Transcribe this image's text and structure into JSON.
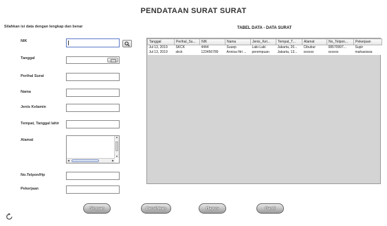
{
  "app_title": "PENDATAAN SURAT SURAT",
  "instruction": "Silahkan isi data dengan lengkap dan benar",
  "table_title": "TABEL DATA - DATA SURAT",
  "form": {
    "nik_label": "NIK",
    "tanggal_label": "Tanggal",
    "perihal_label": "Perihal Surat",
    "nama_label": "Nama",
    "jenis_kelamin_label": "Jenis Kelamin",
    "ttl_label": "Tempat, Tanggal lahir",
    "alamat_label": "Alamat",
    "telpon_label": "No.Telpon/Hp",
    "pekerjaan_label": "Pekerjaan"
  },
  "table": {
    "columns": [
      "Tanggal",
      "Perihal_Su...",
      "NIK",
      "Nama",
      "Jenis_Kel...",
      "Tempat_T...",
      "Alamat",
      "No_Telpon...",
      "Pekerjaan"
    ],
    "rows": [
      [
        "Jul 13, 2019",
        "SKCK",
        "4444",
        "Suuep",
        "Laki-Laki",
        "Jakarta, 20...",
        "Cibubur",
        "08570997...",
        "Supir"
      ],
      [
        "Jul 13, 2019",
        "skck",
        "123456789",
        "Annisa fitri ...",
        "perempuan",
        "Jakarta, 13...",
        "xxxxxx",
        "xxxxxx",
        "mahasiswa"
      ]
    ]
  },
  "buttons": {
    "simpan": "Simpan",
    "bersihkan": "Bersihkan",
    "hapus": "Hapus",
    "ganti": "Ganti"
  },
  "icons": {
    "search": "search-icon",
    "calendar": "calendar-icon",
    "refresh": "refresh-icon"
  }
}
